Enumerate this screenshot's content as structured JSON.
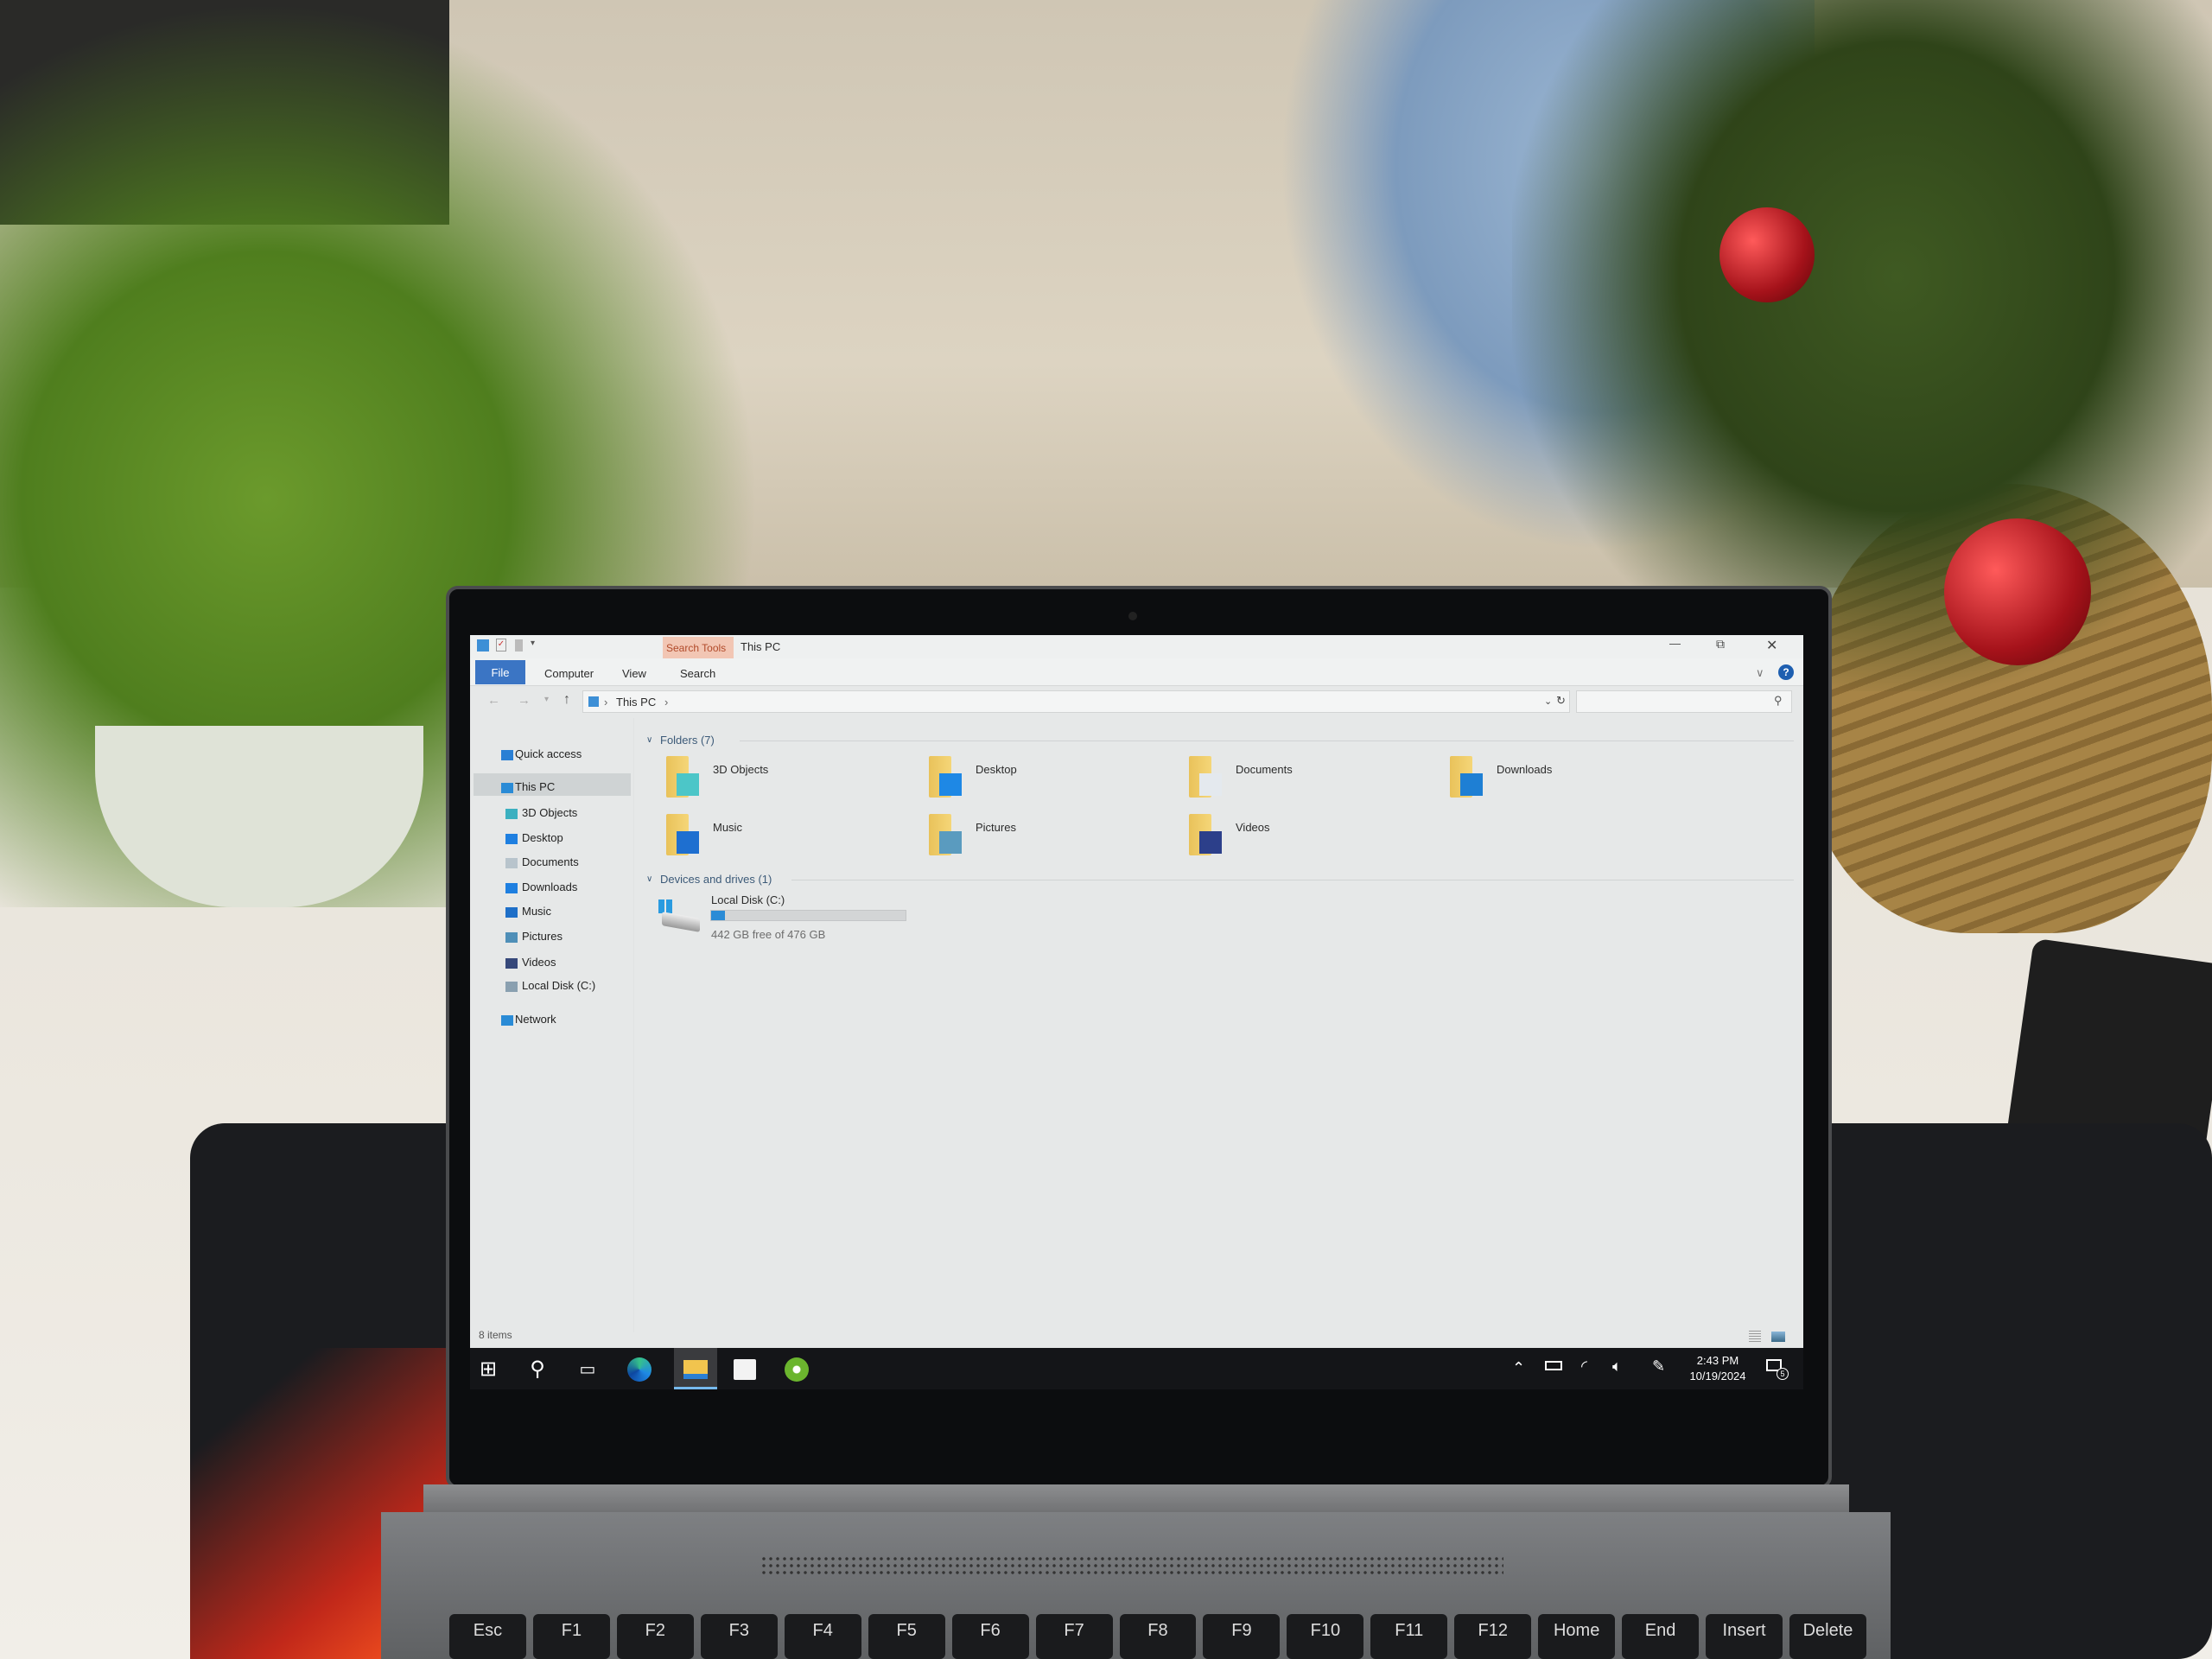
{
  "window": {
    "title": "This PC",
    "contextual_tab": "Search Tools",
    "ribbon_tabs": [
      {
        "label": "File"
      },
      {
        "label": "Computer"
      },
      {
        "label": "View"
      },
      {
        "label": "Search"
      }
    ],
    "controls": {
      "minimize": "—",
      "restore": "⧉",
      "close": "✕",
      "help": "?",
      "expand": "∨"
    }
  },
  "address": {
    "breadcrumb": [
      "This PC"
    ],
    "separator": "›",
    "search_placeholder": ""
  },
  "sidebar": {
    "items": [
      {
        "label": "Quick access",
        "icon": "star-icon",
        "color": "#2a7fd4"
      },
      {
        "label": "This PC",
        "icon": "computer-icon",
        "selected": true,
        "color": "#2a8bd6"
      },
      {
        "label": "3D Objects",
        "icon": "cube-icon",
        "color": "#3bb0c0"
      },
      {
        "label": "Desktop",
        "icon": "desktop-icon",
        "color": "#1e7fe0"
      },
      {
        "label": "Documents",
        "icon": "document-icon",
        "color": "#b8c4cc"
      },
      {
        "label": "Downloads",
        "icon": "download-icon",
        "color": "#1e7fe0"
      },
      {
        "label": "Music",
        "icon": "music-icon",
        "color": "#1e6fc8"
      },
      {
        "label": "Pictures",
        "icon": "picture-icon",
        "color": "#4f8fb8"
      },
      {
        "label": "Videos",
        "icon": "video-icon",
        "color": "#36487a"
      },
      {
        "label": "Local Disk (C:)",
        "icon": "drive-icon",
        "color": "#8aa0b0"
      },
      {
        "label": "Network",
        "icon": "network-icon",
        "color": "#2a8bd6"
      }
    ]
  },
  "folders": {
    "header": "Folders (7)",
    "items": [
      {
        "label": "3D Objects",
        "icon": "cube-icon",
        "badge": "#4cc6c8"
      },
      {
        "label": "Desktop",
        "icon": "desktop-icon",
        "badge": "#1e88e5"
      },
      {
        "label": "Documents",
        "icon": "document-icon",
        "badge": "#e4e9ee"
      },
      {
        "label": "Downloads",
        "icon": "download-icon",
        "badge": "#1e7fd4"
      },
      {
        "label": "Music",
        "icon": "music-icon",
        "badge": "#1e6fd0"
      },
      {
        "label": "Pictures",
        "icon": "picture-icon",
        "badge": "#5a9bbf"
      },
      {
        "label": "Videos",
        "icon": "video-icon",
        "badge": "#2c3f8a"
      }
    ]
  },
  "drives": {
    "header": "Devices and drives (1)",
    "items": [
      {
        "label": "Local Disk (C:)",
        "free_text": "442 GB free of 476 GB",
        "free_gb": 442,
        "total_gb": 476,
        "bar_color": "#2a8bd6"
      }
    ]
  },
  "status": {
    "items": "8 items"
  },
  "taskbar": {
    "apps": [
      "windows-start-icon",
      "search-icon",
      "task-view-icon",
      "edge-icon",
      "file-explorer-icon",
      "store-icon",
      "coccoc-icon"
    ],
    "active_app": "file-explorer-icon",
    "tray": {
      "time": "2:43 PM",
      "date": "10/19/2024",
      "notifications": "5"
    }
  },
  "keyboard": {
    "keys": [
      "Esc",
      "F1",
      "F2",
      "F3",
      "F4",
      "F5",
      "F6",
      "F7",
      "F8",
      "F9",
      "F10",
      "F11",
      "F12",
      "Home",
      "End",
      "Insert",
      "Delete"
    ]
  }
}
